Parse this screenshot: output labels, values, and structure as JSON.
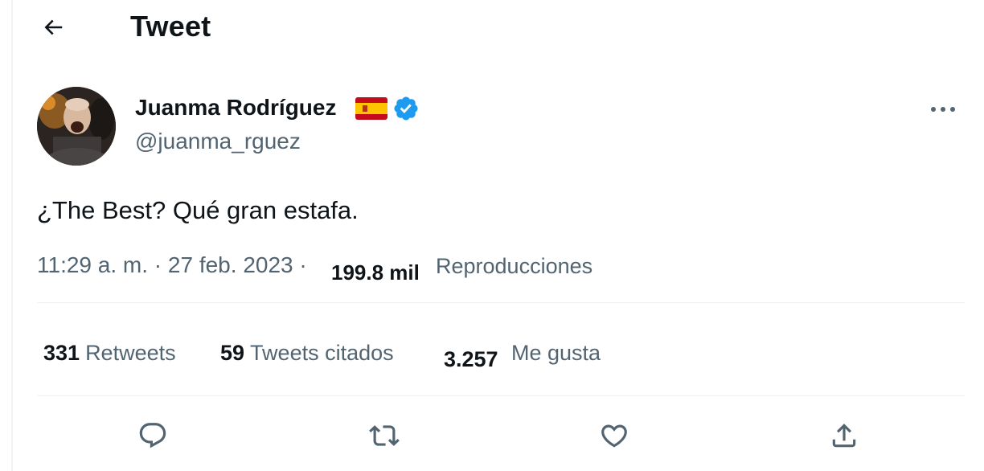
{
  "header": {
    "back_icon": "arrow-left-icon",
    "title": "Tweet"
  },
  "tweet": {
    "author": {
      "name": "Juanma Rodríguez",
      "handle": "@juanma_rguez",
      "flag_icon": "spain-flag-icon",
      "verified_icon": "verified-badge-icon",
      "verified_color": "#1d9bf0"
    },
    "more_icon": "more-horizontal-icon",
    "text": "¿The Best? Qué gran estafa.",
    "time": "11:29 a. m.",
    "separator_1": "·",
    "date": "27 feb. 2023",
    "separator_2": "·",
    "views_count": "199.8 mil",
    "views_label": "Reproducciones",
    "stats": {
      "retweets_count": "331",
      "retweets_label": "Retweets",
      "quotes_count": "59",
      "quotes_label": "Tweets citados",
      "likes_count": "3.257",
      "likes_label": "Me gusta"
    },
    "actions": [
      "reply-icon",
      "retweet-icon",
      "like-icon",
      "share-icon"
    ]
  },
  "colors": {
    "text_primary": "#0f1419",
    "text_secondary": "#536471",
    "divider": "#eff3f4",
    "accent": "#1d9bf0"
  }
}
